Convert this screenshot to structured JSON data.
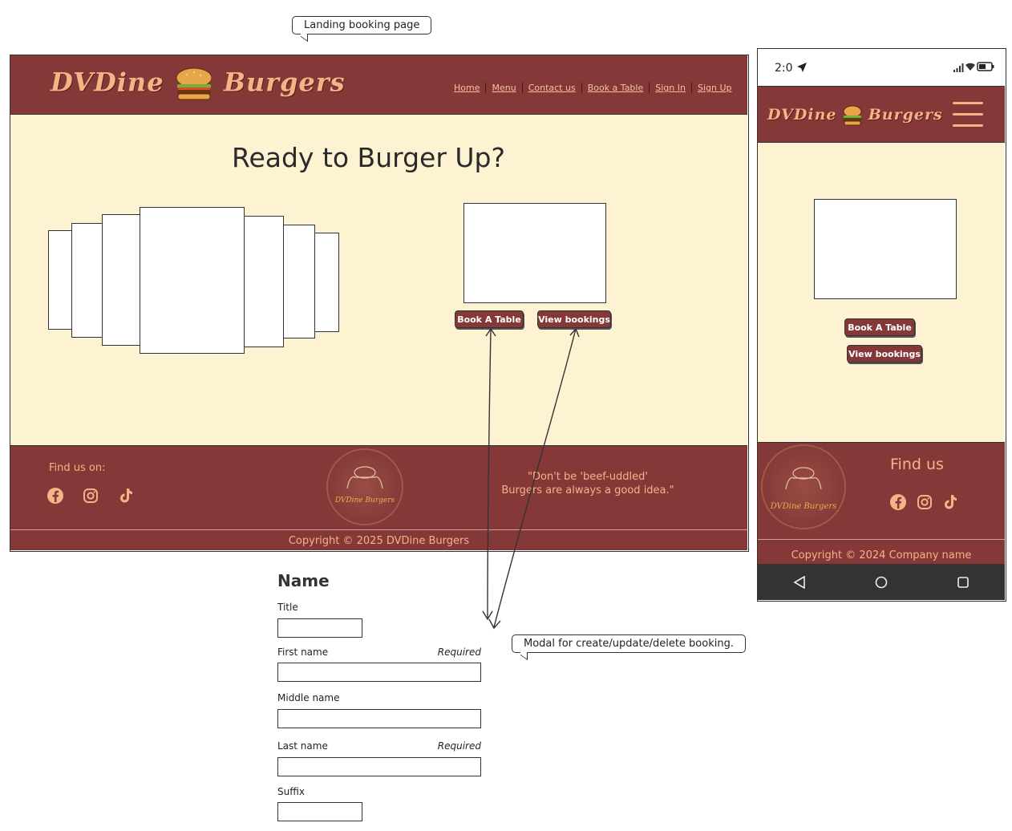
{
  "callouts": {
    "landing": "Landing booking page",
    "modal": "Modal for create/update/delete booking."
  },
  "brand": {
    "part1": "DVDine",
    "part2": "Burgers"
  },
  "nav": [
    "Home",
    "Menu",
    "Contact us",
    "Book a Table",
    "Sign In",
    "Sign Up"
  ],
  "hero": {
    "heading": "Ready to Burger Up?",
    "book_button": "Book A Table",
    "view_button": "View bookings"
  },
  "footer": {
    "find_us": "Find us on:",
    "badge_text": "DVDine Burgers",
    "quote_line1": "\"Don't be 'beef-uddled'",
    "quote_line2": "Burgers are always a good idea.\"",
    "copyright": "Copyright © 2025 DVDine Burgers"
  },
  "mobile": {
    "time": "2:0",
    "brand1": "DVDine",
    "brand2": "Burgers",
    "book_button": "Book A Table",
    "view_button": "View bookings",
    "find_us": "Find us",
    "badge_text": "DVDine Burgers",
    "copyright": "Copyright © 2024 Company name"
  },
  "form": {
    "heading": "Name",
    "title_label": "Title",
    "first_label": "First name",
    "middle_label": "Middle name",
    "last_label": "Last name",
    "suffix_label": "Suffix",
    "required": "Required"
  },
  "colors": {
    "maroon": "#843838",
    "cream": "#fdf2d2",
    "accent": "#f4b486"
  },
  "icons": [
    "facebook-icon",
    "instagram-icon",
    "tiktok-icon",
    "location-arrow-icon",
    "signal-icon",
    "wifi-icon",
    "battery-icon",
    "menu-icon",
    "back-icon",
    "home-icon",
    "recents-icon"
  ]
}
